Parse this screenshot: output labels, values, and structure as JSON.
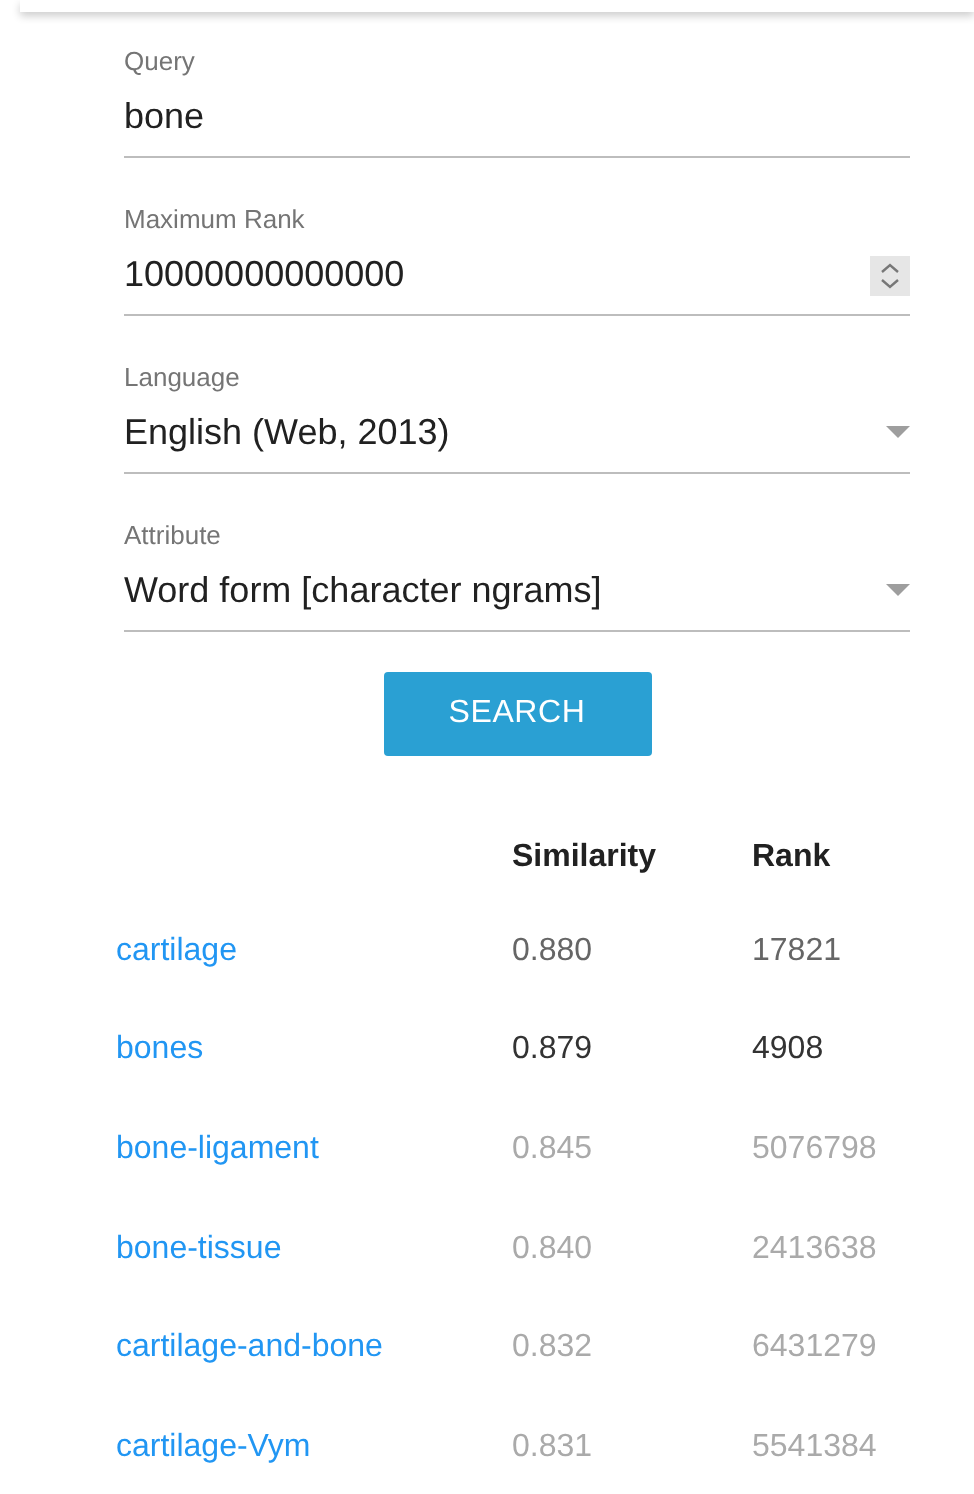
{
  "form": {
    "fields": [
      {
        "kind": "text",
        "label": "Query",
        "value": "bone"
      },
      {
        "kind": "number",
        "label": "Maximum Rank",
        "value": "10000000000000"
      },
      {
        "kind": "select",
        "label": "Language",
        "value": "English (Web, 2013)"
      },
      {
        "kind": "select",
        "label": "Attribute",
        "value": "Word form [character ngrams]"
      }
    ],
    "search_button": "SEARCH"
  },
  "table": {
    "columns": [
      "Similarity",
      "Rank"
    ],
    "rows": [
      {
        "word": "cartilage",
        "similarity": "0.880",
        "rank": "17821",
        "color": "#666666"
      },
      {
        "word": "bones",
        "similarity": "0.879",
        "rank": "4908",
        "color": "#333333"
      },
      {
        "word": "bone-ligament",
        "similarity": "0.845",
        "rank": "5076798",
        "color": "#aaaaaa"
      },
      {
        "word": "bone-tissue",
        "similarity": "0.840",
        "rank": "2413638",
        "color": "#aaaaaa"
      },
      {
        "word": "cartilage-and-bone",
        "similarity": "0.832",
        "rank": "6431279",
        "color": "#aaaaaa"
      },
      {
        "word": "cartilage-Vym",
        "similarity": "0.831",
        "rank": "5541384",
        "color": "#aaaaaa"
      }
    ]
  }
}
